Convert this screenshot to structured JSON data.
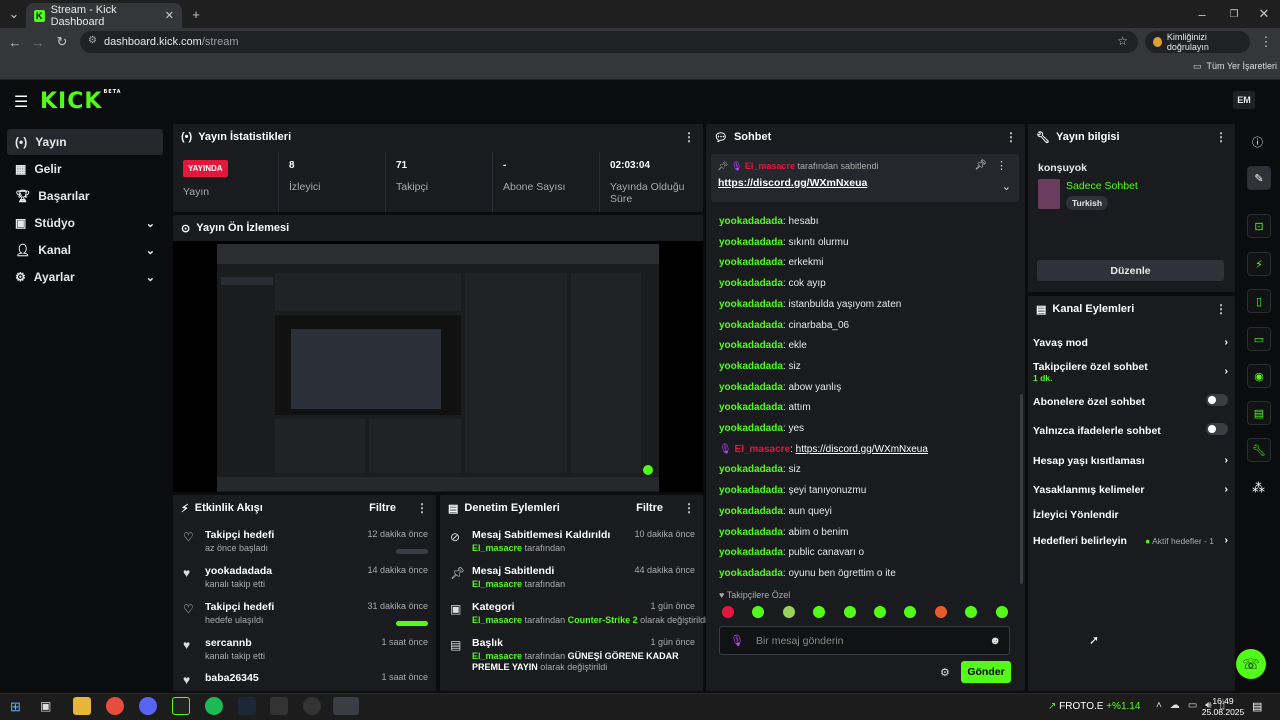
{
  "browser": {
    "tab_title": "Stream - Kick Dashboard",
    "url_host": "dashboard.kick.com",
    "url_path": "/stream",
    "identity_button": "Kimliğinizi doğrulayın",
    "bookmarks_label": "Tüm Yer İşaretleri"
  },
  "app": {
    "logo": "KICK",
    "logo_badge": "BETA",
    "avatar_initials": "EM"
  },
  "sidebar": {
    "items": [
      {
        "label": "Yayın",
        "icon": "broadcast-icon",
        "active": true
      },
      {
        "label": "Gelir",
        "icon": "revenue-icon"
      },
      {
        "label": "Başarılar",
        "icon": "trophy-icon"
      },
      {
        "label": "Stüdyo",
        "icon": "studio-icon"
      },
      {
        "label": "Kanal",
        "icon": "channel-icon"
      },
      {
        "label": "Ayarlar",
        "icon": "gear-icon"
      }
    ]
  },
  "stats": {
    "title": "Yayın İstatistikleri",
    "live_badge": "YAYINDA",
    "live_label": "Yayın",
    "viewers_value": "8",
    "viewers_label": "İzleyici",
    "followers_value": "71",
    "followers_label": "Takipçi",
    "subs_value": "-",
    "subs_label": "Abone Sayısı",
    "uptime_value": "02:03:04",
    "uptime_label": "Yayında Olduğu Süre"
  },
  "preview": {
    "title": "Yayın Ön İzlemesi"
  },
  "activity": {
    "title": "Etkinlik Akışı",
    "filter": "Filtre",
    "rows": [
      {
        "title": "Takipçi hedefi",
        "sub": "az önce başladı",
        "time": "12 dakika önce",
        "progress": 0
      },
      {
        "title": "yookadadada",
        "sub": "kanalı takip etti",
        "time": "14 dakika önce"
      },
      {
        "title": "Takipçi hedefi",
        "sub": "hedefe ulaşıldı",
        "time": "31 dakika önce",
        "progress": 1
      },
      {
        "title": "sercannb",
        "sub": "kanalı takip etti",
        "time": "1 saat önce"
      },
      {
        "title": "baba26345",
        "sub": "",
        "time": "1 saat önce"
      }
    ]
  },
  "moderation": {
    "title": "Denetim Eylemleri",
    "filter": "Filtre",
    "rows": [
      {
        "title": "Mesaj Sabitlemesi Kaldırıldı",
        "user": "El_masacre",
        "suffix": "tarafından",
        "time": "10 dakika önce"
      },
      {
        "title": "Mesaj Sabitlendi",
        "user": "El_masacre",
        "suffix": "tarafından",
        "time": "44 dakika önce"
      },
      {
        "title": "Kategori",
        "user": "El_masacre",
        "suffix": "tarafından",
        "extra_green": "Counter-Strike 2",
        "extra_tail": "olarak değiştirildi",
        "time": "1 gün önce"
      },
      {
        "title": "Başlık",
        "user": "El_masacre",
        "suffix": "tarafından",
        "extra_bold": "GÜNEŞİ GÖRENE KADAR PREMLE YAYIN",
        "extra_tail": "olarak değiştirildi",
        "time": "1 gün önce"
      }
    ]
  },
  "chat": {
    "title": "Sohbet",
    "pinned_user": "El_masacre",
    "pinned_suffix": "tarafından sabitlendi",
    "pinned_link": "https://discord.gg/WXmNxeua",
    "messages": [
      {
        "user": "yookadadada",
        "text": "hesabı"
      },
      {
        "user": "yookadadada",
        "text": "sıkıntı olurmu"
      },
      {
        "user": "yookadadada",
        "text": "erkekmi"
      },
      {
        "user": "yookadadada",
        "text": "cok ayıp"
      },
      {
        "user": "yookadadada",
        "text": "istanbulda yaşıyom zaten"
      },
      {
        "user": "yookadadada",
        "text": "cinarbaba_06"
      },
      {
        "user": "yookadadada",
        "text": "ekle"
      },
      {
        "user": "yookadadada",
        "text": "siz"
      },
      {
        "user": "yookadadada",
        "text": "abow yanlış"
      },
      {
        "user": "yookadadada",
        "text": "attım"
      },
      {
        "user": "yookadadada",
        "text": "yes"
      },
      {
        "user": "El_masacre",
        "text": "https://discord.gg/WXmNxeua",
        "mod": true
      },
      {
        "user": "yookadadada",
        "text": "siz"
      },
      {
        "user": "yookadadada",
        "text": "şeyi tanıyonuzmu"
      },
      {
        "user": "yookadadada",
        "text": "aun queyi"
      },
      {
        "user": "yookadadada",
        "text": "abim o benim"
      },
      {
        "user": "yookadadada",
        "text": "public canavarı o"
      },
      {
        "user": "yookadadada",
        "text": "oyunu ben ögrettim o ite"
      }
    ],
    "followers_only": "Takipçilere Özel",
    "input_placeholder": "Bir mesaj gönderin",
    "send_button": "Gönder"
  },
  "stream_info": {
    "title": "Yayın bilgisi",
    "stream_title": "konşuyok",
    "category": "Sadece Sohbet",
    "tag": "Turkish",
    "edit_button": "Düzenle"
  },
  "channel_actions": {
    "title": "Kanal Eylemleri",
    "rows": [
      {
        "label": "Yavaş mod",
        "type": "chevron"
      },
      {
        "label": "Takipçilere özel sohbet",
        "sub": "1 dk.",
        "type": "chevron"
      },
      {
        "label": "Abonelere özel sohbet",
        "type": "toggle"
      },
      {
        "label": "Yalnızca ifadelerle sohbet",
        "type": "toggle"
      },
      {
        "label": "Hesap yaşı kısıtlaması",
        "type": "chevron"
      },
      {
        "label": "Yasaklanmış kelimeler",
        "type": "chevron"
      },
      {
        "label": "İzleyici Yönlendir",
        "type": "none"
      },
      {
        "label": "Hedefleri belirleyin",
        "status": "Aktif hedefler - 1",
        "type": "chevron"
      }
    ]
  },
  "taskbar": {
    "ticker": "FROTO.E",
    "ticker_change": "+%1.14",
    "time": "16:49",
    "date": "25.08.2025"
  },
  "colors": {
    "accent": "#53fc18",
    "live": "#e3163c",
    "panel": "#191b1f"
  }
}
